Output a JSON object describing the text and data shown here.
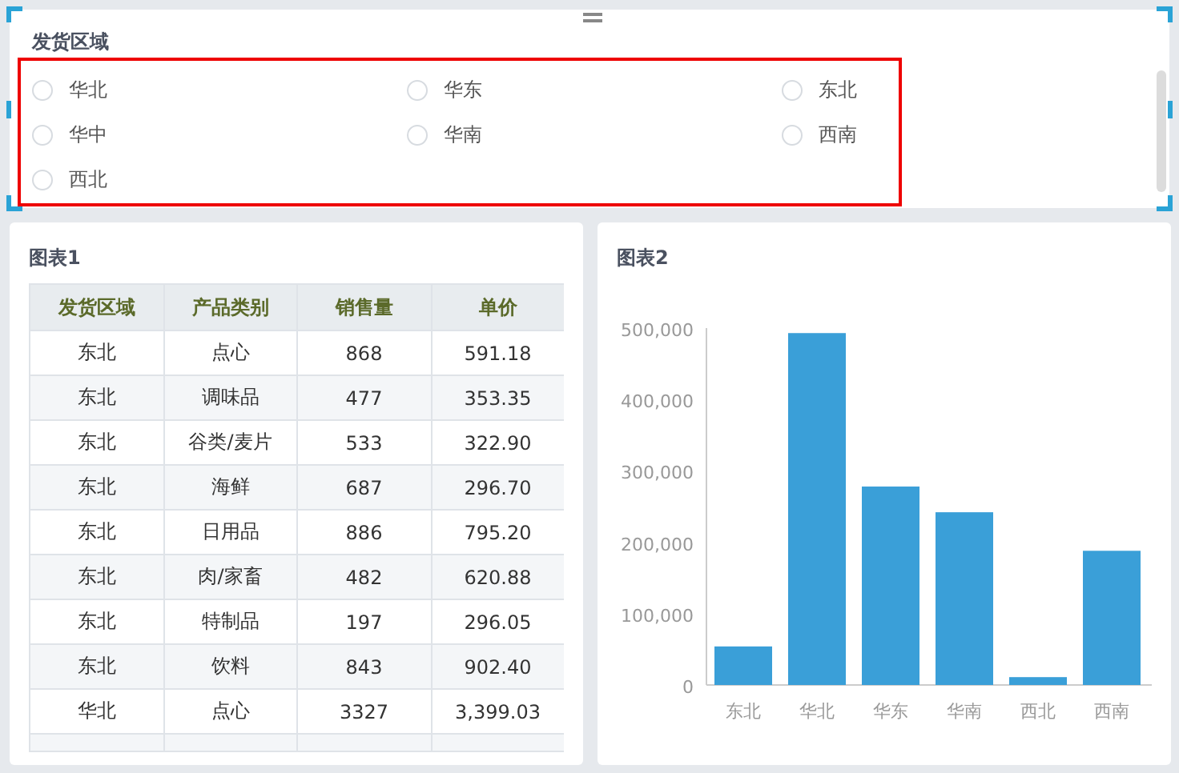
{
  "filter": {
    "title": "发货区域",
    "options": [
      {
        "label": "华北",
        "selected": false
      },
      {
        "label": "华东",
        "selected": false
      },
      {
        "label": "东北",
        "selected": false
      },
      {
        "label": "华中",
        "selected": false
      },
      {
        "label": "华南",
        "selected": false
      },
      {
        "label": "西南",
        "selected": false
      },
      {
        "label": "西北",
        "selected": false
      }
    ]
  },
  "table_panel": {
    "title": "图表1",
    "columns": [
      "发货区域",
      "产品类别",
      "销售量",
      "单价"
    ],
    "rows": [
      [
        "东北",
        "点心",
        "868",
        "591.18"
      ],
      [
        "东北",
        "调味品",
        "477",
        "353.35"
      ],
      [
        "东北",
        "谷类/麦片",
        "533",
        "322.90"
      ],
      [
        "东北",
        "海鲜",
        "687",
        "296.70"
      ],
      [
        "东北",
        "日用品",
        "886",
        "795.20"
      ],
      [
        "东北",
        "肉/家畜",
        "482",
        "620.88"
      ],
      [
        "东北",
        "特制品",
        "197",
        "296.05"
      ],
      [
        "东北",
        "饮料",
        "843",
        "902.40"
      ],
      [
        "华北",
        "点心",
        "3327",
        "3,399.03"
      ]
    ]
  },
  "chart_panel": {
    "title": "图表2",
    "chart_data": {
      "type": "bar",
      "categories": [
        "东北",
        "华北",
        "华东",
        "华南",
        "西北",
        "西南"
      ],
      "series": [
        {
          "color": "#3a9fd8",
          "values": [
            54000,
            493000,
            278000,
            242000,
            11000,
            188000
          ]
        }
      ],
      "ylim": [
        0,
        500000
      ],
      "yticks": [
        {
          "value": 0,
          "label": "0"
        },
        {
          "value": 100000,
          "label": "100,000"
        },
        {
          "value": 200000,
          "label": "200,000"
        },
        {
          "value": 300000,
          "label": "300,000"
        },
        {
          "value": 400000,
          "label": "400,000"
        },
        {
          "value": 500000,
          "label": "500,000"
        }
      ]
    }
  }
}
